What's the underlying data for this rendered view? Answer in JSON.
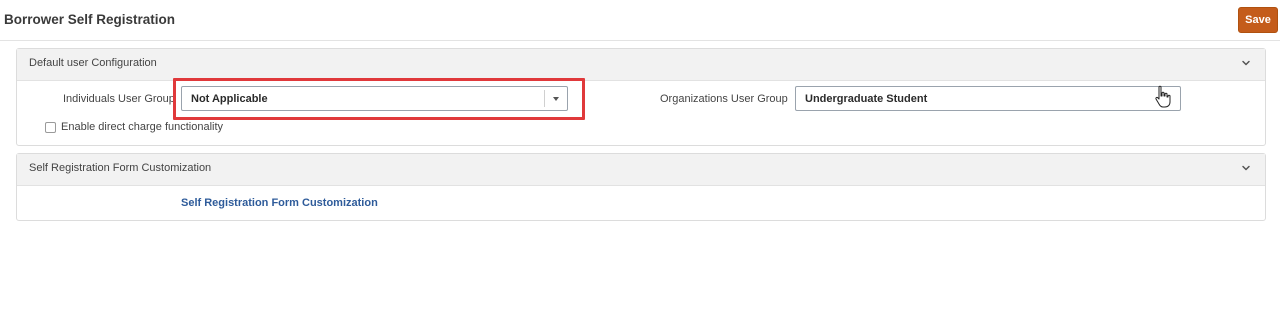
{
  "header": {
    "title": "Borrower Self Registration",
    "save_label": "Save",
    "save_color": "#c45c1b"
  },
  "default_config": {
    "title": "Default user Configuration",
    "individuals": {
      "label": "Individuals User Group",
      "value": "Not Applicable"
    },
    "organizations": {
      "label": "Organizations User Group",
      "value": "Undergraduate Student"
    },
    "direct_charge": {
      "label": "Enable direct charge functionality",
      "checked": false
    },
    "highlight_color": "#e0393b"
  },
  "form_customization": {
    "title": "Self Registration Form Customization",
    "link_label": "Self Registration Form Customization",
    "link_color": "#2e5b9a"
  },
  "icons": {
    "collapse": "chevron-down-icon",
    "select": "caret-down-icon",
    "pointer": "hand-cursor-icon"
  }
}
